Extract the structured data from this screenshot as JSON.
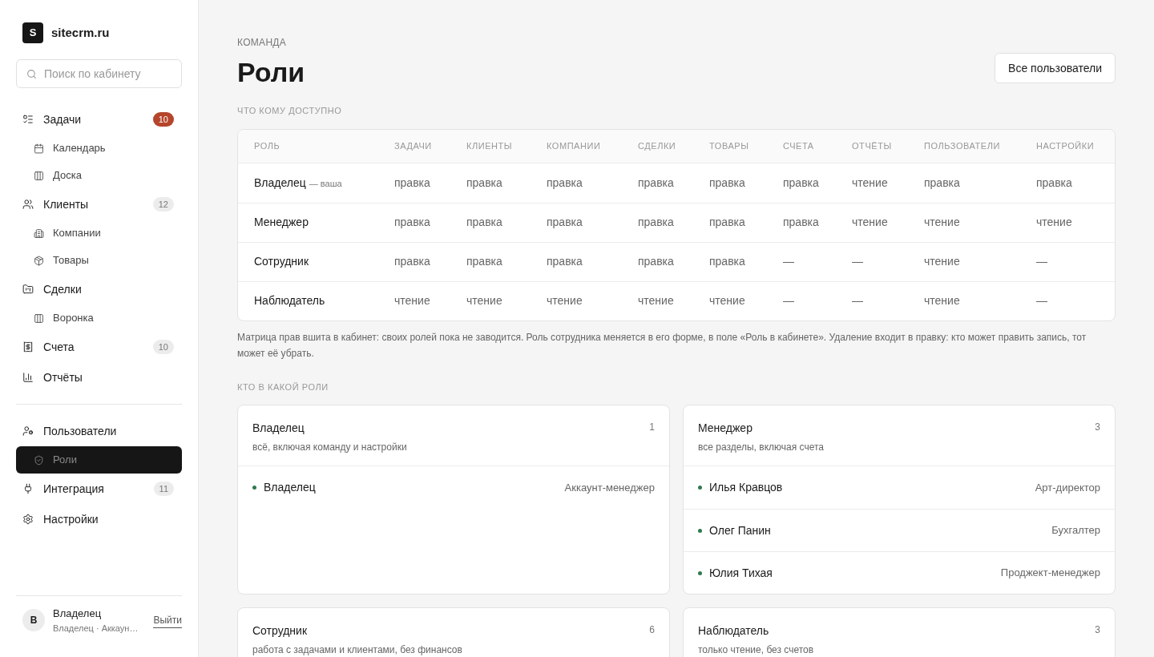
{
  "brand": {
    "logo": "S",
    "name": "sitecrm.ru"
  },
  "search": {
    "placeholder": "Поиск по кабинету"
  },
  "nav_groups": [
    {
      "items": [
        {
          "kind": "item",
          "label": "Задачи",
          "badge": "10",
          "color": "#b5452b",
          "selected": false
        },
        {
          "kind": "subitem",
          "label": "Календарь",
          "selected": false
        },
        {
          "kind": "subitem",
          "label": "Доска",
          "selected": false
        },
        {
          "kind": "item",
          "label": "Клиенты",
          "badge": "12",
          "color": "#ececec",
          "selected": false
        },
        {
          "kind": "subitem",
          "label": "Компании",
          "selected": false
        },
        {
          "kind": "subitem",
          "label": "Товары",
          "selected": false
        },
        {
          "kind": "item",
          "label": "Сделки",
          "selected": false
        },
        {
          "kind": "subitem",
          "label": "Воронка",
          "selected": false
        },
        {
          "kind": "item",
          "label": "Счета",
          "badge": "10",
          "color": "#ececec",
          "selected": false
        },
        {
          "kind": "item",
          "label": "Отчёты",
          "selected": false
        }
      ]
    },
    {
      "items": [
        {
          "kind": "item",
          "label": "Пользователи",
          "selected": false
        },
        {
          "kind": "subitem",
          "label": "Роли",
          "selected": true
        },
        {
          "kind": "item",
          "label": "Интеграция",
          "badge": "11",
          "color": "#ececec",
          "selected": false
        },
        {
          "kind": "item",
          "label": "Настройки",
          "selected": false
        }
      ]
    }
  ],
  "user": {
    "initial": "В",
    "name": "Владелец",
    "role": "Владелец · Аккаун…",
    "logout": "Выйти"
  },
  "header": {
    "eyebrow": "КОМАНДА",
    "title": "Роли",
    "button": "Все пользователи"
  },
  "matrix": {
    "caption": "ЧТО КОМУ ДОСТУПНО",
    "columns": [
      "РОЛЬ",
      "ЗАДАЧИ",
      "КЛИЕНТЫ",
      "КОМПАНИИ",
      "СДЕЛКИ",
      "ТОВАРЫ",
      "СЧЕТА",
      "ОТЧЁТЫ",
      "ПОЛЬЗОВАТЕЛИ",
      "НАСТРОЙКИ"
    ],
    "rows": [
      {
        "note": "— ваша",
        "cells": [
          "Владелец",
          "правка",
          "правка",
          "правка",
          "правка",
          "правка",
          "правка",
          "чтение",
          "правка",
          "правка"
        ]
      },
      {
        "cells": [
          "Менеджер",
          "правка",
          "правка",
          "правка",
          "правка",
          "правка",
          "правка",
          "чтение",
          "чтение",
          "чтение"
        ]
      },
      {
        "cells": [
          "Сотрудник",
          "правка",
          "правка",
          "правка",
          "правка",
          "правка",
          "—",
          "—",
          "чтение",
          "—"
        ]
      },
      {
        "cells": [
          "Наблюдатель",
          "чтение",
          "чтение",
          "чтение",
          "чтение",
          "чтение",
          "—",
          "—",
          "чтение",
          "—"
        ]
      }
    ],
    "footnote": "Матрица прав вшита в кабинет: своих ролей пока не заводится. Роль сотрудника меняется в его форме, в поле «Роль в кабинете». Удаление входит в правку: кто может править запись, тот может её убрать."
  },
  "roles": {
    "caption": "КТО В КАКОЙ РОЛИ",
    "cards": [
      {
        "title": "Владелец",
        "subtitle": "всё, включая команду и настройки",
        "count": "1",
        "members": [
          {
            "name": "Владелец",
            "position": "Аккаунт-менеджер"
          }
        ]
      },
      {
        "title": "Менеджер",
        "subtitle": "все разделы, включая счета",
        "count": "3",
        "members": [
          {
            "name": "Илья Кравцов",
            "position": "Арт-директор"
          },
          {
            "name": "Олег Панин",
            "position": "Бухгалтер"
          },
          {
            "name": "Юлия Тихая",
            "position": "Проджект-менеджер"
          }
        ]
      },
      {
        "title": "Сотрудник",
        "subtitle": "работа с задачами и клиентами, без финансов",
        "count": "6"
      },
      {
        "title": "Наблюдатель",
        "subtitle": "только чтение, без счетов",
        "count": "3"
      }
    ]
  }
}
